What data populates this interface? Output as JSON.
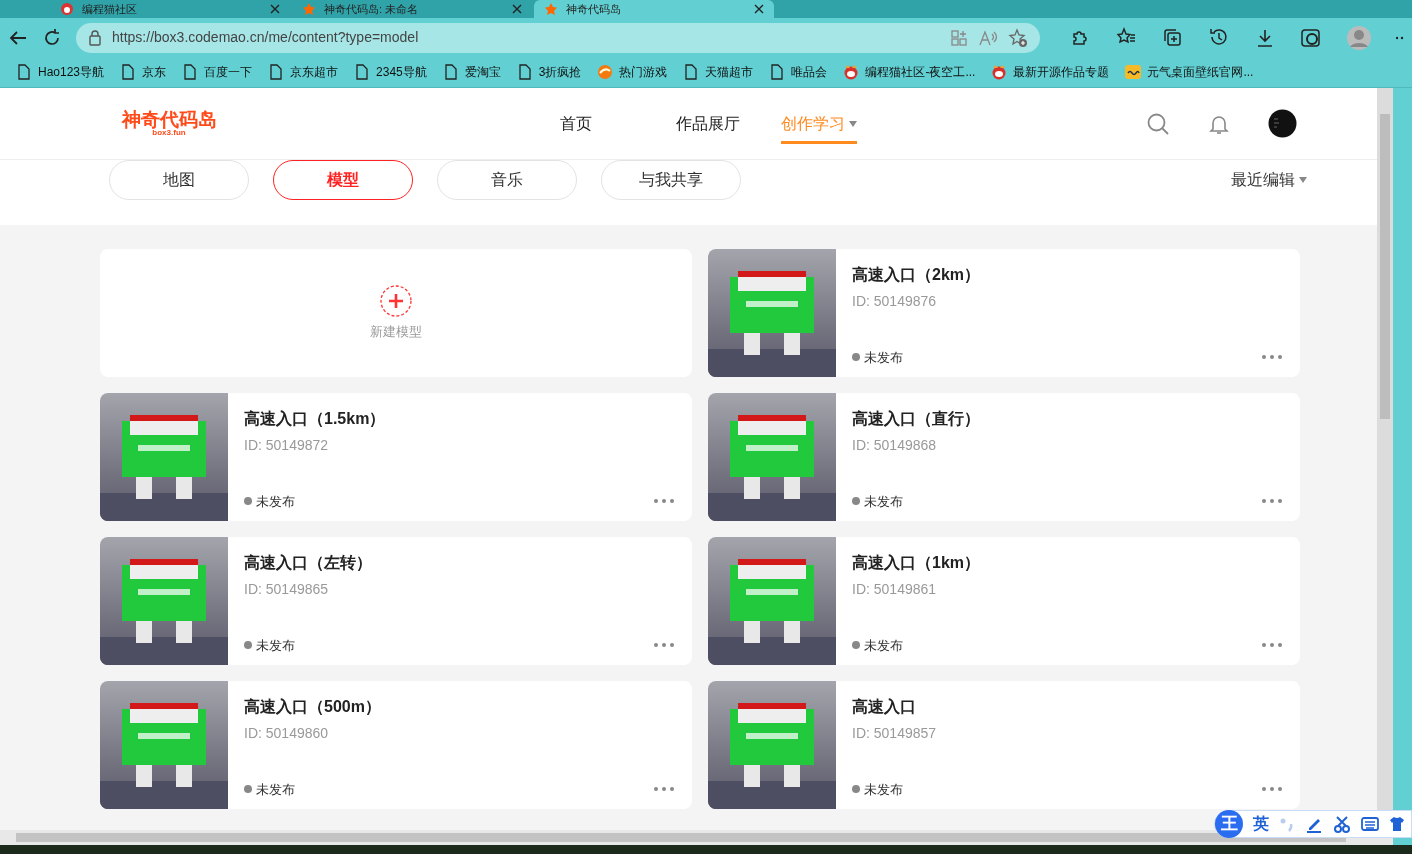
{
  "browser": {
    "tabs": [
      {
        "title": "编程猫社区",
        "kind": "cat",
        "selected": false
      },
      {
        "title": "神奇代码岛: 未命名",
        "kind": "star",
        "selected": false
      },
      {
        "title": "神奇代码岛",
        "kind": "star",
        "selected": true
      }
    ],
    "url": "https://box3.codemao.cn/me/content?type=model",
    "bookmarks": [
      {
        "label": "Hao123导航",
        "kind": "page"
      },
      {
        "label": "京东",
        "kind": "page"
      },
      {
        "label": "百度一下",
        "kind": "page"
      },
      {
        "label": "京东超市",
        "kind": "page"
      },
      {
        "label": "2345导航",
        "kind": "page"
      },
      {
        "label": "爱淘宝",
        "kind": "page"
      },
      {
        "label": "3折疯抢",
        "kind": "page"
      },
      {
        "label": "热门游戏",
        "kind": "game"
      },
      {
        "label": "天猫超市",
        "kind": "page"
      },
      {
        "label": "唯品会",
        "kind": "page"
      },
      {
        "label": "编程猫社区-夜空工...",
        "kind": "cat"
      },
      {
        "label": "最新开源作品专题",
        "kind": "cat"
      },
      {
        "label": "元气桌面壁纸官网...",
        "kind": "wallpaper"
      }
    ]
  },
  "header": {
    "logo": "神奇代码岛",
    "logo_sub": "box3.fun",
    "nav": [
      {
        "label": "首页",
        "selected": false,
        "dropdown": false
      },
      {
        "label": "作品展厅",
        "selected": false,
        "dropdown": false
      },
      {
        "label": "创作学习",
        "selected": true,
        "dropdown": true
      }
    ]
  },
  "filters": [
    {
      "label": "地图",
      "selected": false
    },
    {
      "label": "模型",
      "selected": true
    },
    {
      "label": "音乐",
      "selected": false
    },
    {
      "label": "与我共享",
      "selected": false
    }
  ],
  "sort": "最近编辑",
  "new_model": "新建模型",
  "models": [
    {
      "title": "高速入口（2km）",
      "id": "ID: 50149876",
      "status": "未发布",
      "kind": "picture"
    },
    {
      "title": "高速入口（1.5km）",
      "id": "ID: 50149872",
      "status": "未发布",
      "kind": "picture"
    },
    {
      "title": "高速入口（直行）",
      "id": "ID: 50149868",
      "status": "未发布",
      "kind": "picture"
    },
    {
      "title": "高速入口（左转）",
      "id": "ID: 50149865",
      "status": "未发布",
      "kind": "picture"
    },
    {
      "title": "高速入口（1km）",
      "id": "ID: 50149861",
      "status": "未发布",
      "kind": "picture"
    },
    {
      "title": "高速入口（500m）",
      "id": "ID: 50149860",
      "status": "未发布",
      "kind": "picture"
    },
    {
      "title": "高速入口",
      "id": "ID: 50149857",
      "status": "未发布",
      "kind": "picture"
    }
  ],
  "ime": {
    "logo": "王",
    "mode": "英"
  }
}
